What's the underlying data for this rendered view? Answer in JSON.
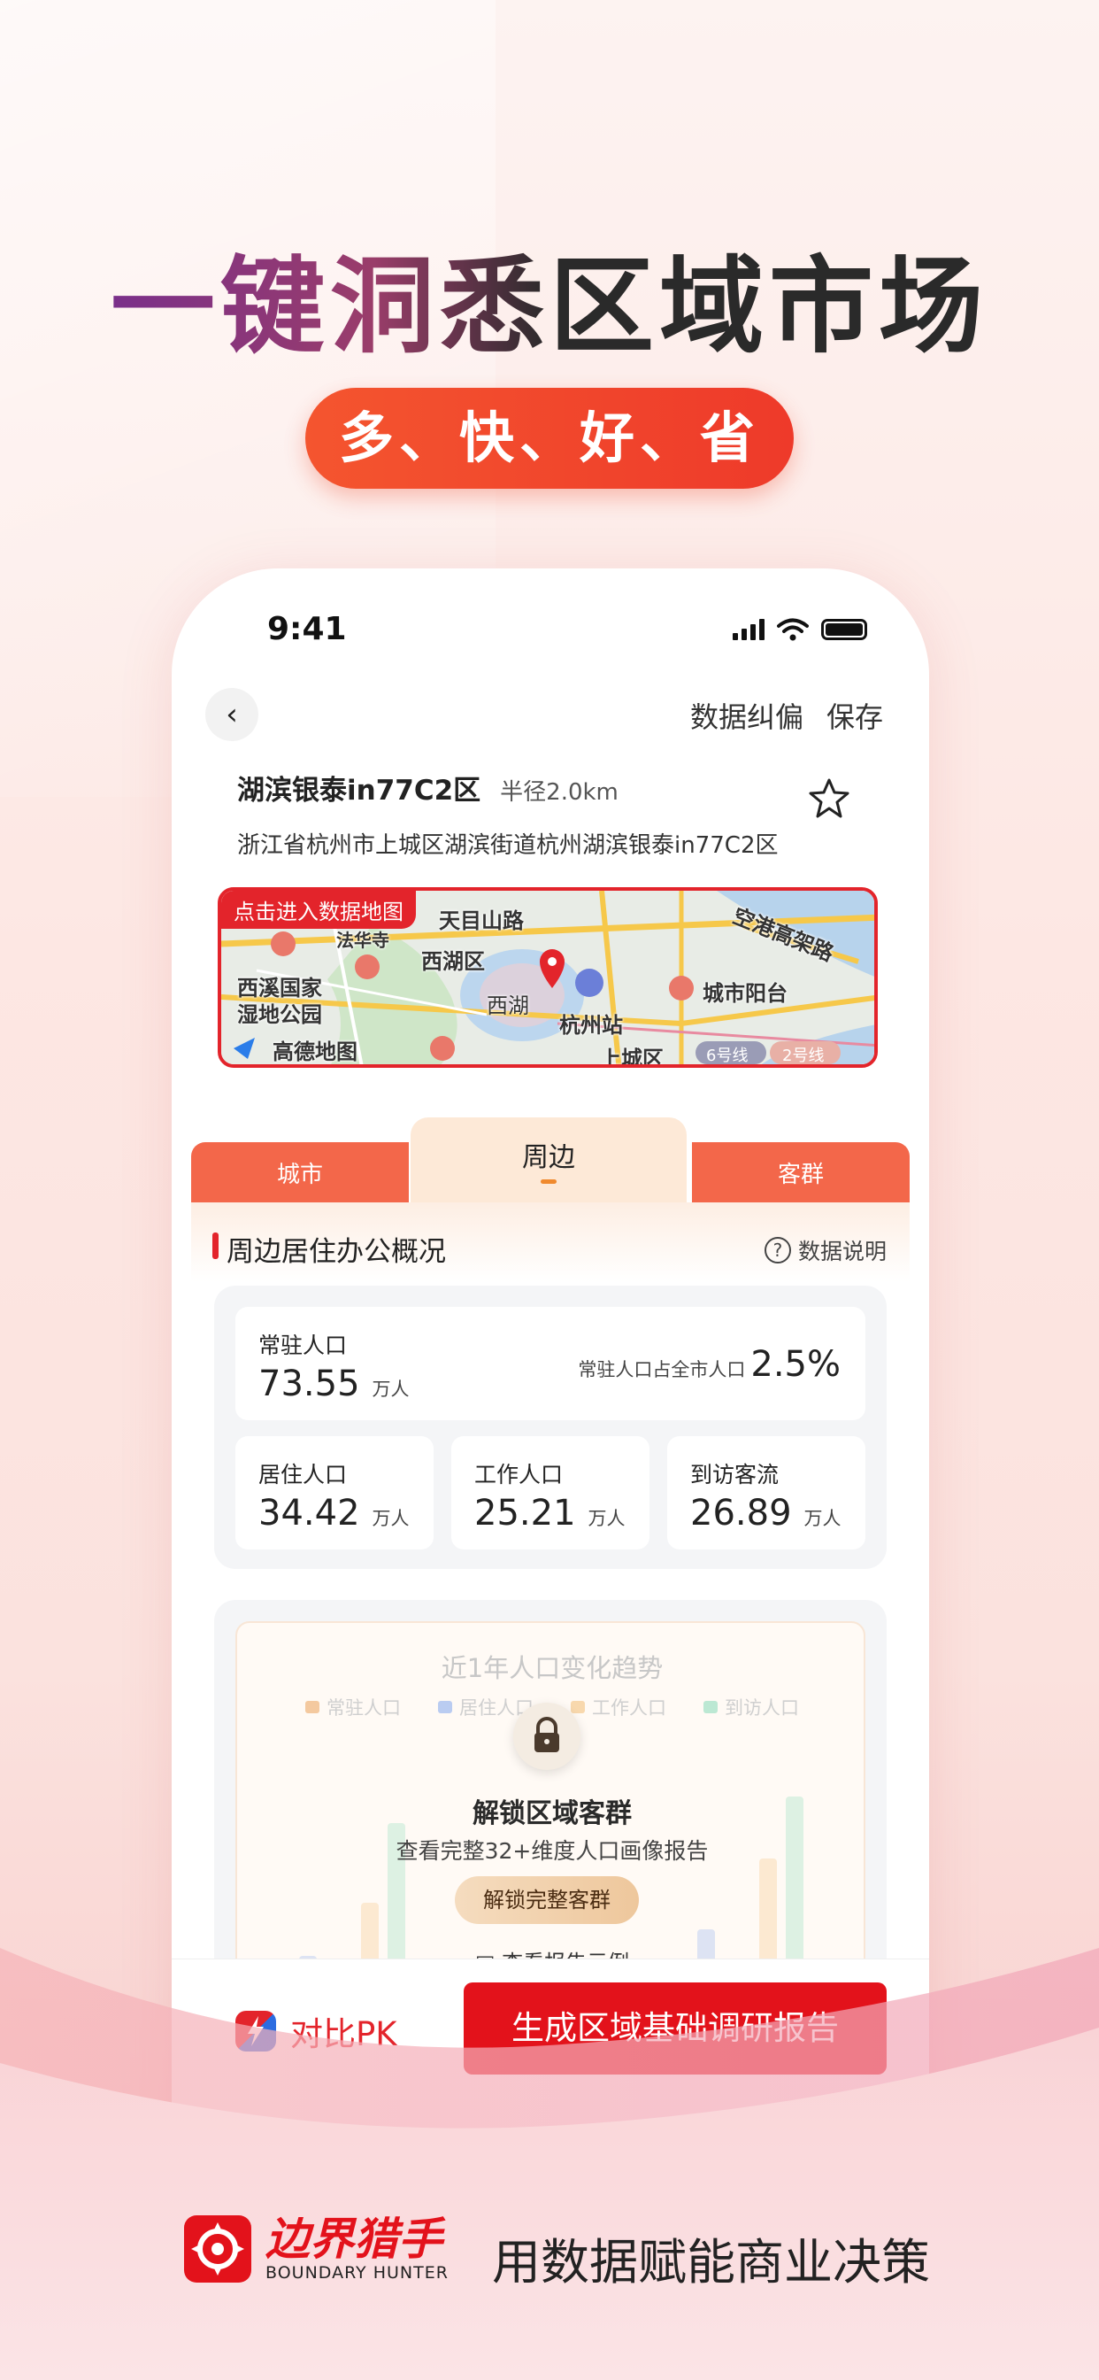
{
  "headline": {
    "part1": "一键洞悉",
    "part2": "区域市场"
  },
  "pill_text": "多、快、好、省",
  "status_bar": {
    "time": "9:41"
  },
  "nav": {
    "correct_label": "数据纠偏",
    "save_label": "保存"
  },
  "location": {
    "name": "湖滨银泰in77C2区",
    "radius": "半径2.0km",
    "address": "浙江省杭州市上城区湖滨街道杭州湖滨银泰in77C2区"
  },
  "map": {
    "badge": "点击进入数据地图",
    "labels": {
      "tianmushan": "天目山路",
      "fahua": "法华寺",
      "xihuqu": "西湖区",
      "kongport": "空港高架路",
      "xixi": "西溪国家",
      "wetland": "湿地公园",
      "xihu": "西湖",
      "hzstation": "杭州站",
      "chengshi": "城市阳台",
      "gaode": "高德地图",
      "shangcheng": "上城区",
      "line6": "6号线",
      "line2": "2号线"
    }
  },
  "tabs": {
    "left": "城市",
    "middle": "周边",
    "right": "客群"
  },
  "section": {
    "title": "周边居住办公概况",
    "help": "数据说明"
  },
  "stats": {
    "resident": {
      "label": "常驻人口",
      "value": "73.55",
      "unit": "万人",
      "share_label": "常驻人口占全市人口",
      "share_value": "2.5%"
    },
    "living": {
      "label": "居住人口",
      "value": "34.42",
      "unit": "万人"
    },
    "working": {
      "label": "工作人口",
      "value": "25.21",
      "unit": "万人"
    },
    "visitors": {
      "label": "到访客流",
      "value": "26.89",
      "unit": "万人"
    }
  },
  "trend": {
    "title": "近1年人口变化趋势",
    "legend": [
      "常驻人口",
      "居住人口",
      "工作人口",
      "到访人口"
    ],
    "legend_colors": [
      "#f0b37b",
      "#9db8f0",
      "#f5c98f",
      "#9fe0c4"
    ],
    "unlock_title": "解锁区域客群",
    "unlock_sub": "查看完整32+维度人口画像报告",
    "unlock_button": "解锁完整客群",
    "sample_link": "查看报告示例"
  },
  "bottom": {
    "pk_label": "对比PK",
    "report_button": "生成区域基础调研报告"
  },
  "brand": {
    "name_cn": "边界猎手",
    "name_en": "BOUNDARY HUNTER",
    "slogan": "用数据赋能商业决策"
  },
  "colors": {
    "accent": "#e3242b",
    "tab_orange": "#f3674a"
  }
}
